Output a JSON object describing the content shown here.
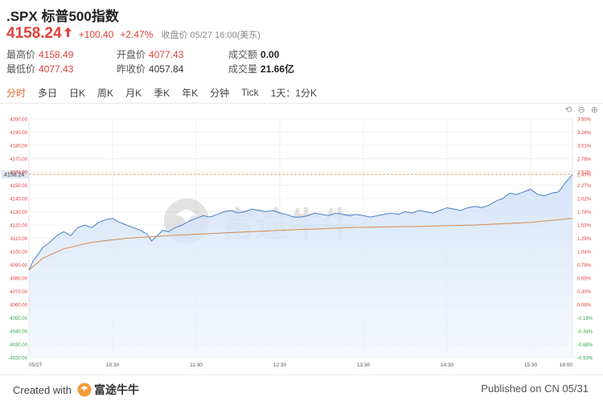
{
  "header": {
    "title": ".SPX 标普500指数",
    "price": "4158.24",
    "change": "+100.40",
    "change_pct": "+2.47%",
    "close_info": "收盘价 05/27 16:00(美东)"
  },
  "stats": {
    "high_label": "最高价",
    "high": "4158.49",
    "low_label": "最低价",
    "low": "4077.43",
    "open_label": "开盘价",
    "open": "4077.43",
    "prev_label": "昨收价",
    "prev": "4057.84",
    "amount_label": "成交额",
    "amount": "0.00",
    "volume_label": "成交量",
    "volume": "21.66亿"
  },
  "tabs": [
    "分时",
    "多日",
    "日K",
    "周K",
    "月K",
    "季K",
    "年K",
    "分钟",
    "Tick"
  ],
  "active_tab": 0,
  "tab_extra": "1天：1分K",
  "colors": {
    "up": "#e1413a",
    "down": "#2ea84a",
    "accent": "#e36d2c",
    "line": "#4a80c6",
    "avg": "#d8894a"
  },
  "chart_data": {
    "type": "area",
    "x_ticks": [
      "05/27",
      "10:30",
      "11:30",
      "12:30",
      "13:30",
      "14:30",
      "15:30",
      "16:00"
    ],
    "y_ticks": [
      "4200.00",
      "4190.00",
      "4180.00",
      "4170.00",
      "4160.00",
      "4150.00",
      "4140.00",
      "4130.00",
      "4120.00",
      "4110.00",
      "4100.00",
      "4090.00",
      "4080.00",
      "4070.00",
      "4060.00",
      "4050.00",
      "4040.00",
      "4030.00",
      "4020.00"
    ],
    "pct_ticks": [
      "3.50%",
      "3.26%",
      "3.01%",
      "2.76%",
      "2.52%",
      "2.27%",
      "2.02%",
      "1.78%",
      "1.53%",
      "1.29%",
      "1.04%",
      "0.79%",
      "0.55%",
      "0.30%",
      "0.06%",
      "-0.19%",
      "-0.44%",
      "-0.68%",
      "-0.93%"
    ],
    "current_label": "4158.24",
    "current_pct": "2.47%",
    "ylim": [
      4020,
      4200
    ],
    "x_minutes": [
      0,
      60,
      120,
      180,
      240,
      300,
      360,
      390
    ],
    "price_series": [
      [
        0,
        4086
      ],
      [
        3,
        4093
      ],
      [
        6,
        4097
      ],
      [
        10,
        4103
      ],
      [
        15,
        4107
      ],
      [
        20,
        4112
      ],
      [
        25,
        4115
      ],
      [
        30,
        4112
      ],
      [
        35,
        4118
      ],
      [
        40,
        4120
      ],
      [
        45,
        4118
      ],
      [
        50,
        4122
      ],
      [
        55,
        4124
      ],
      [
        60,
        4125
      ],
      [
        65,
        4122
      ],
      [
        70,
        4120
      ],
      [
        75,
        4118
      ],
      [
        80,
        4116
      ],
      [
        85,
        4113
      ],
      [
        88,
        4108
      ],
      [
        92,
        4112
      ],
      [
        96,
        4116
      ],
      [
        100,
        4115
      ],
      [
        105,
        4118
      ],
      [
        110,
        4120
      ],
      [
        115,
        4123
      ],
      [
        120,
        4125
      ],
      [
        125,
        4127
      ],
      [
        130,
        4126
      ],
      [
        135,
        4128
      ],
      [
        140,
        4130
      ],
      [
        145,
        4131
      ],
      [
        150,
        4129
      ],
      [
        155,
        4130
      ],
      [
        160,
        4132
      ],
      [
        165,
        4131
      ],
      [
        170,
        4130
      ],
      [
        175,
        4131
      ],
      [
        180,
        4129
      ],
      [
        185,
        4128
      ],
      [
        190,
        4126
      ],
      [
        195,
        4126
      ],
      [
        200,
        4127
      ],
      [
        205,
        4129
      ],
      [
        210,
        4128
      ],
      [
        215,
        4127
      ],
      [
        220,
        4129
      ],
      [
        225,
        4128
      ],
      [
        230,
        4127
      ],
      [
        235,
        4128
      ],
      [
        240,
        4127
      ],
      [
        245,
        4126
      ],
      [
        250,
        4127
      ],
      [
        255,
        4128
      ],
      [
        260,
        4129
      ],
      [
        265,
        4128
      ],
      [
        270,
        4130
      ],
      [
        275,
        4129
      ],
      [
        280,
        4131
      ],
      [
        285,
        4130
      ],
      [
        290,
        4129
      ],
      [
        295,
        4131
      ],
      [
        300,
        4133
      ],
      [
        305,
        4132
      ],
      [
        310,
        4131
      ],
      [
        315,
        4133
      ],
      [
        320,
        4134
      ],
      [
        325,
        4133
      ],
      [
        330,
        4135
      ],
      [
        335,
        4138
      ],
      [
        340,
        4140
      ],
      [
        345,
        4144
      ],
      [
        350,
        4143
      ],
      [
        355,
        4145
      ],
      [
        360,
        4147
      ],
      [
        365,
        4143
      ],
      [
        370,
        4142
      ],
      [
        375,
        4144
      ],
      [
        380,
        4145
      ],
      [
        385,
        4152
      ],
      [
        390,
        4158
      ]
    ],
    "avg_series": [
      [
        0,
        4086
      ],
      [
        10,
        4095
      ],
      [
        25,
        4102
      ],
      [
        45,
        4107
      ],
      [
        70,
        4110
      ],
      [
        100,
        4112
      ],
      [
        140,
        4114
      ],
      [
        180,
        4116
      ],
      [
        230,
        4118
      ],
      [
        280,
        4119
      ],
      [
        320,
        4120
      ],
      [
        360,
        4122
      ],
      [
        390,
        4125
      ]
    ]
  },
  "footer": {
    "created_with": "Created with",
    "brand": "富途牛牛",
    "watermark": "富途牛牛",
    "published": "Published on CN 05/31"
  }
}
